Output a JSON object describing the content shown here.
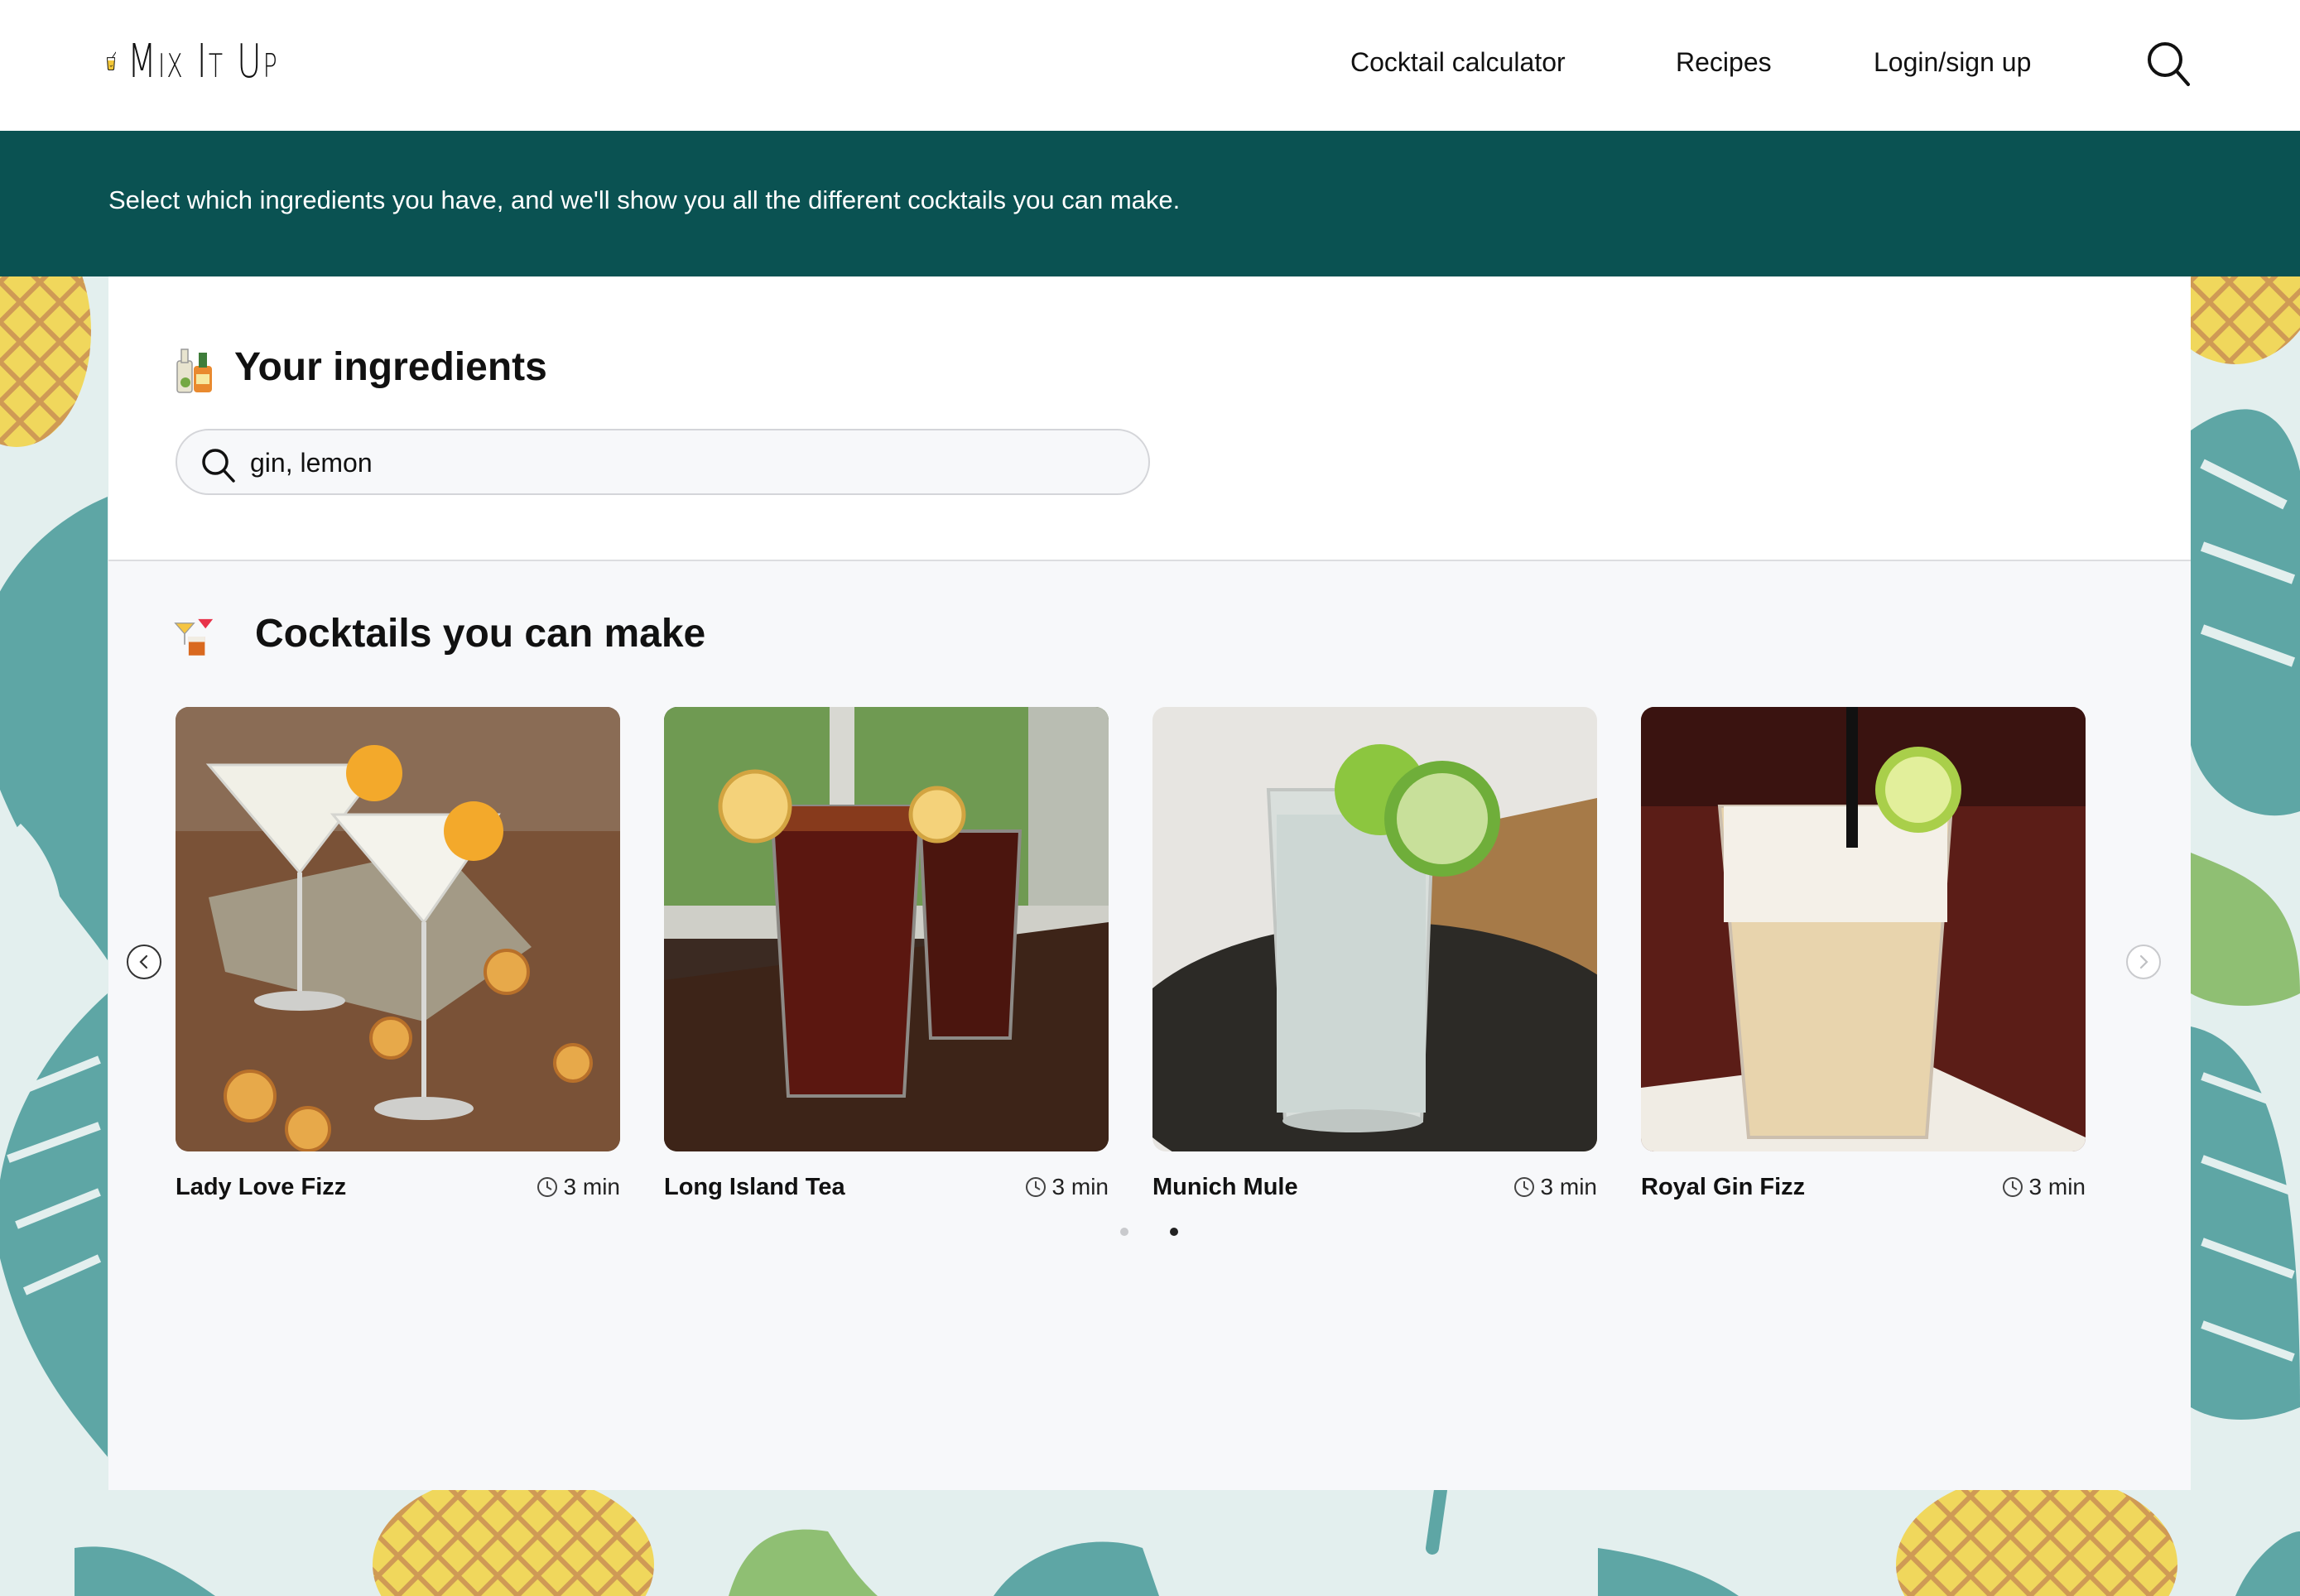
{
  "header": {
    "logo_text": "Mix It Up",
    "nav": {
      "calculator": "Cocktail calculator",
      "recipes": "Recipes",
      "login": "Login/sign up"
    },
    "search_icon": "search-icon"
  },
  "banner": {
    "text": "Select which ingredients you have, and we'll show you all the different cocktails you can make."
  },
  "ingredients": {
    "title": "Your ingredients",
    "icon": "bottles-icon",
    "search_value": "gin, lemon"
  },
  "cocktails": {
    "title": "Cocktails you can make",
    "icon": "cocktail-glasses-icon",
    "cards": [
      {
        "name": "Lady Love Fizz",
        "time": "3 min"
      },
      {
        "name": "Long Island Tea",
        "time": "3 min"
      },
      {
        "name": "Munich Mule",
        "time": "3 min"
      },
      {
        "name": "Royal Gin Fizz",
        "time": "3 min"
      }
    ],
    "pagination": {
      "pages": 2,
      "active": 2
    }
  },
  "colors": {
    "brand_teal": "#0a5252",
    "background": "#e3efee",
    "panel": "#f7f8fa"
  }
}
